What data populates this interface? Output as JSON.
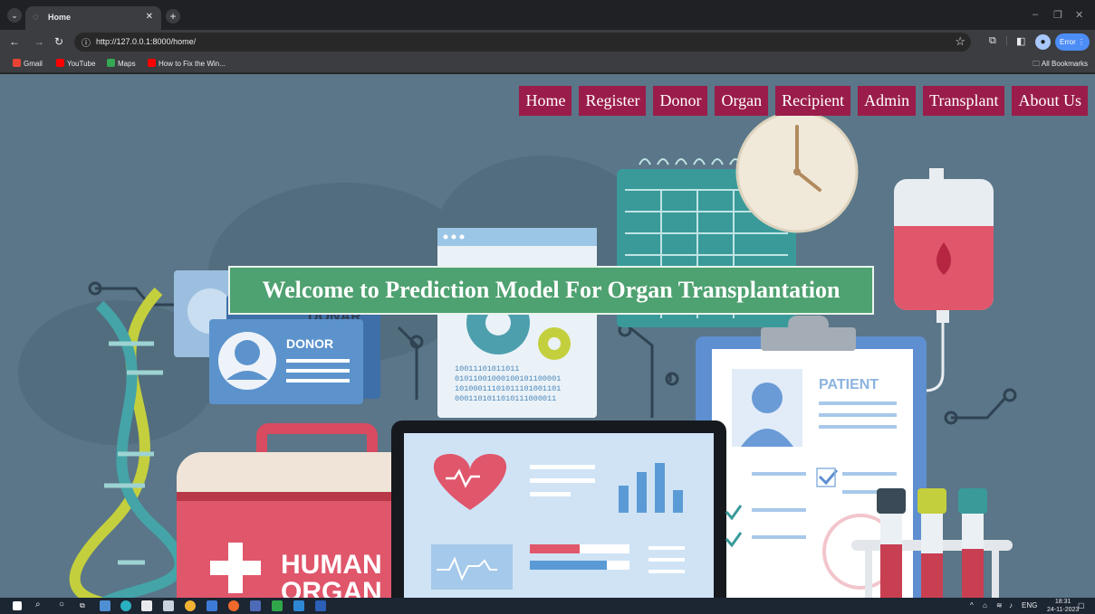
{
  "browser": {
    "tab_title": "Home",
    "url": "http://127.0.0.1:8000/home/",
    "error_label": "Error",
    "bookmarks": [
      {
        "label": "Gmail",
        "color": "#ea4335"
      },
      {
        "label": "YouTube",
        "color": "#ff0000"
      },
      {
        "label": "Maps",
        "color": "#34a853"
      },
      {
        "label": "How to Fix the Win...",
        "color": "#ff0000"
      }
    ],
    "all_bookmarks_label": "All Bookmarks"
  },
  "page": {
    "nav": [
      {
        "label": "Home"
      },
      {
        "label": "Register"
      },
      {
        "label": "Donor"
      },
      {
        "label": "Organ"
      },
      {
        "label": "Recipient"
      },
      {
        "label": "Admin"
      },
      {
        "label": "Transplant"
      },
      {
        "label": "About Us"
      }
    ],
    "welcome": "Welcome to Prediction Model For Organ Transplantation",
    "illustration": {
      "donor_card_label": "DONOR",
      "donor_card_back_label": "DONAR",
      "patient_label": "PATIENT",
      "binary_lines": [
        "10011101011011",
        "01011001000100101100001",
        "10100011101011101001101",
        "0001101011010111000011"
      ],
      "box_text_1": "HUMAN",
      "box_text_2": "ORGAN"
    }
  },
  "colors": {
    "nav_bg": "#9a1c4a",
    "welcome_bg": "#4ea170",
    "page_bg": "#5a7688"
  },
  "taskbar": {
    "language": "ENG",
    "time": "18:31",
    "date": "24-11-2023"
  }
}
